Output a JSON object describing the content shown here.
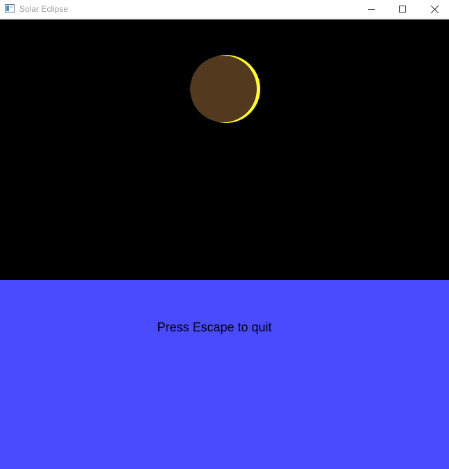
{
  "window": {
    "title": "Solar Eclipse",
    "controls": {
      "minimize": "minimize-icon",
      "maximize": "maximize-icon",
      "close": "close-icon"
    }
  },
  "scene": {
    "sky_color": "#000000",
    "ground_color": "#4a4aff",
    "sun_color": "#ffff1a",
    "moon_color": "#533a1f",
    "message": "Press Escape to quit"
  }
}
